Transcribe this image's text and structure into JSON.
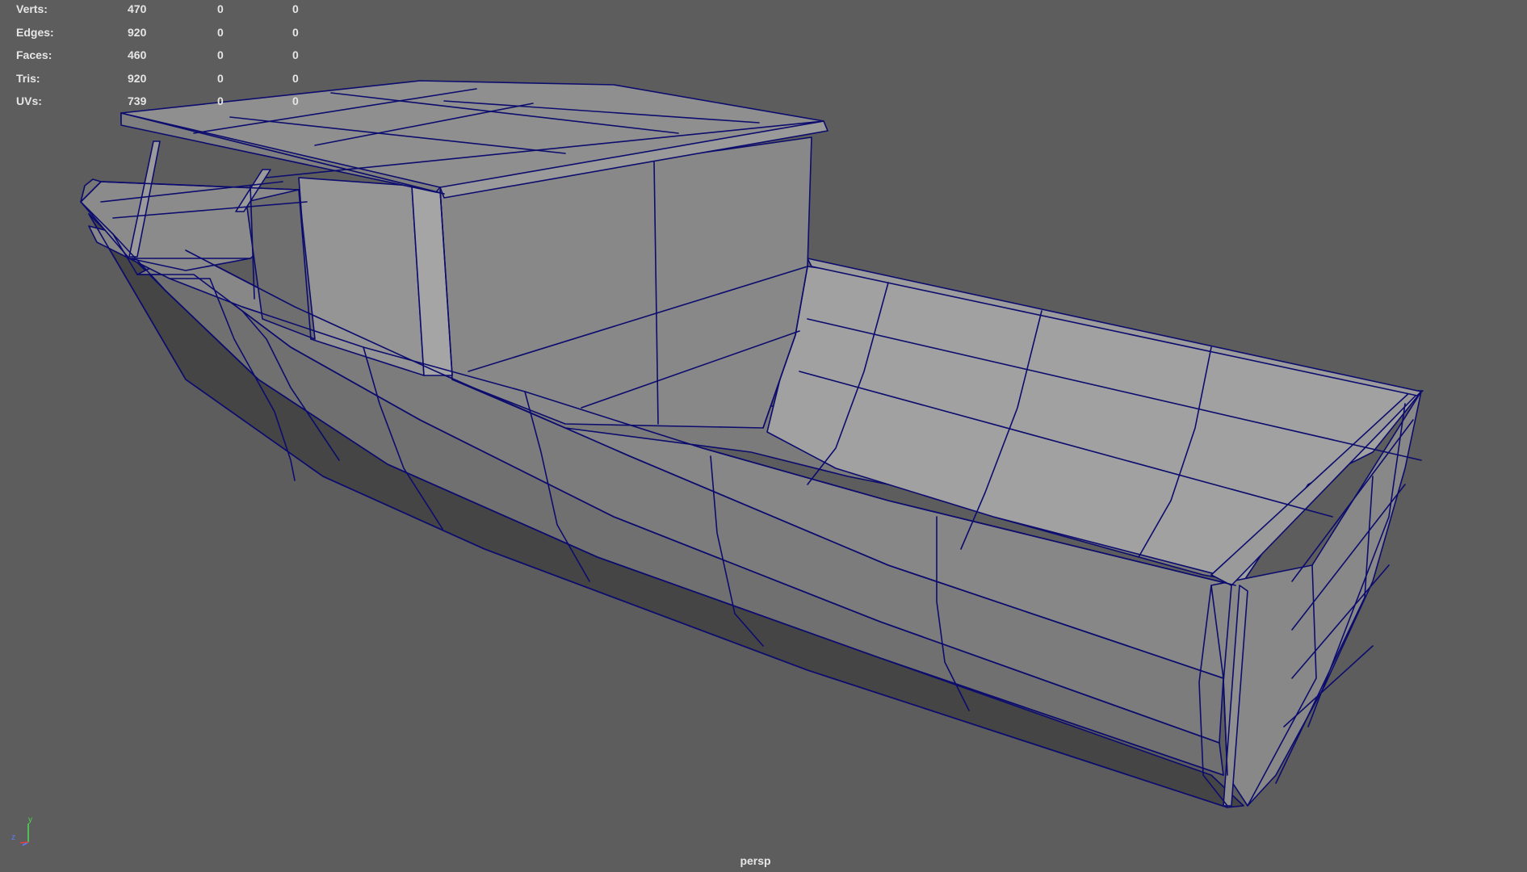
{
  "hud": {
    "rows": [
      {
        "label": "Verts:",
        "v1": "470",
        "v2": "0",
        "v3": "0"
      },
      {
        "label": "Edges:",
        "v1": "920",
        "v2": "0",
        "v3": "0"
      },
      {
        "label": "Faces:",
        "v1": "460",
        "v2": "0",
        "v3": "0"
      },
      {
        "label": "Tris:",
        "v1": "920",
        "v2": "0",
        "v3": "0"
      },
      {
        "label": "UVs:",
        "v1": "739",
        "v2": "0",
        "v3": "0"
      }
    ]
  },
  "viewport": {
    "camera": "persp",
    "background_color": "#5d5d5d",
    "wire_color": "#0c0c6e"
  },
  "axis": {
    "x": "x",
    "y": "y",
    "z": "z"
  }
}
